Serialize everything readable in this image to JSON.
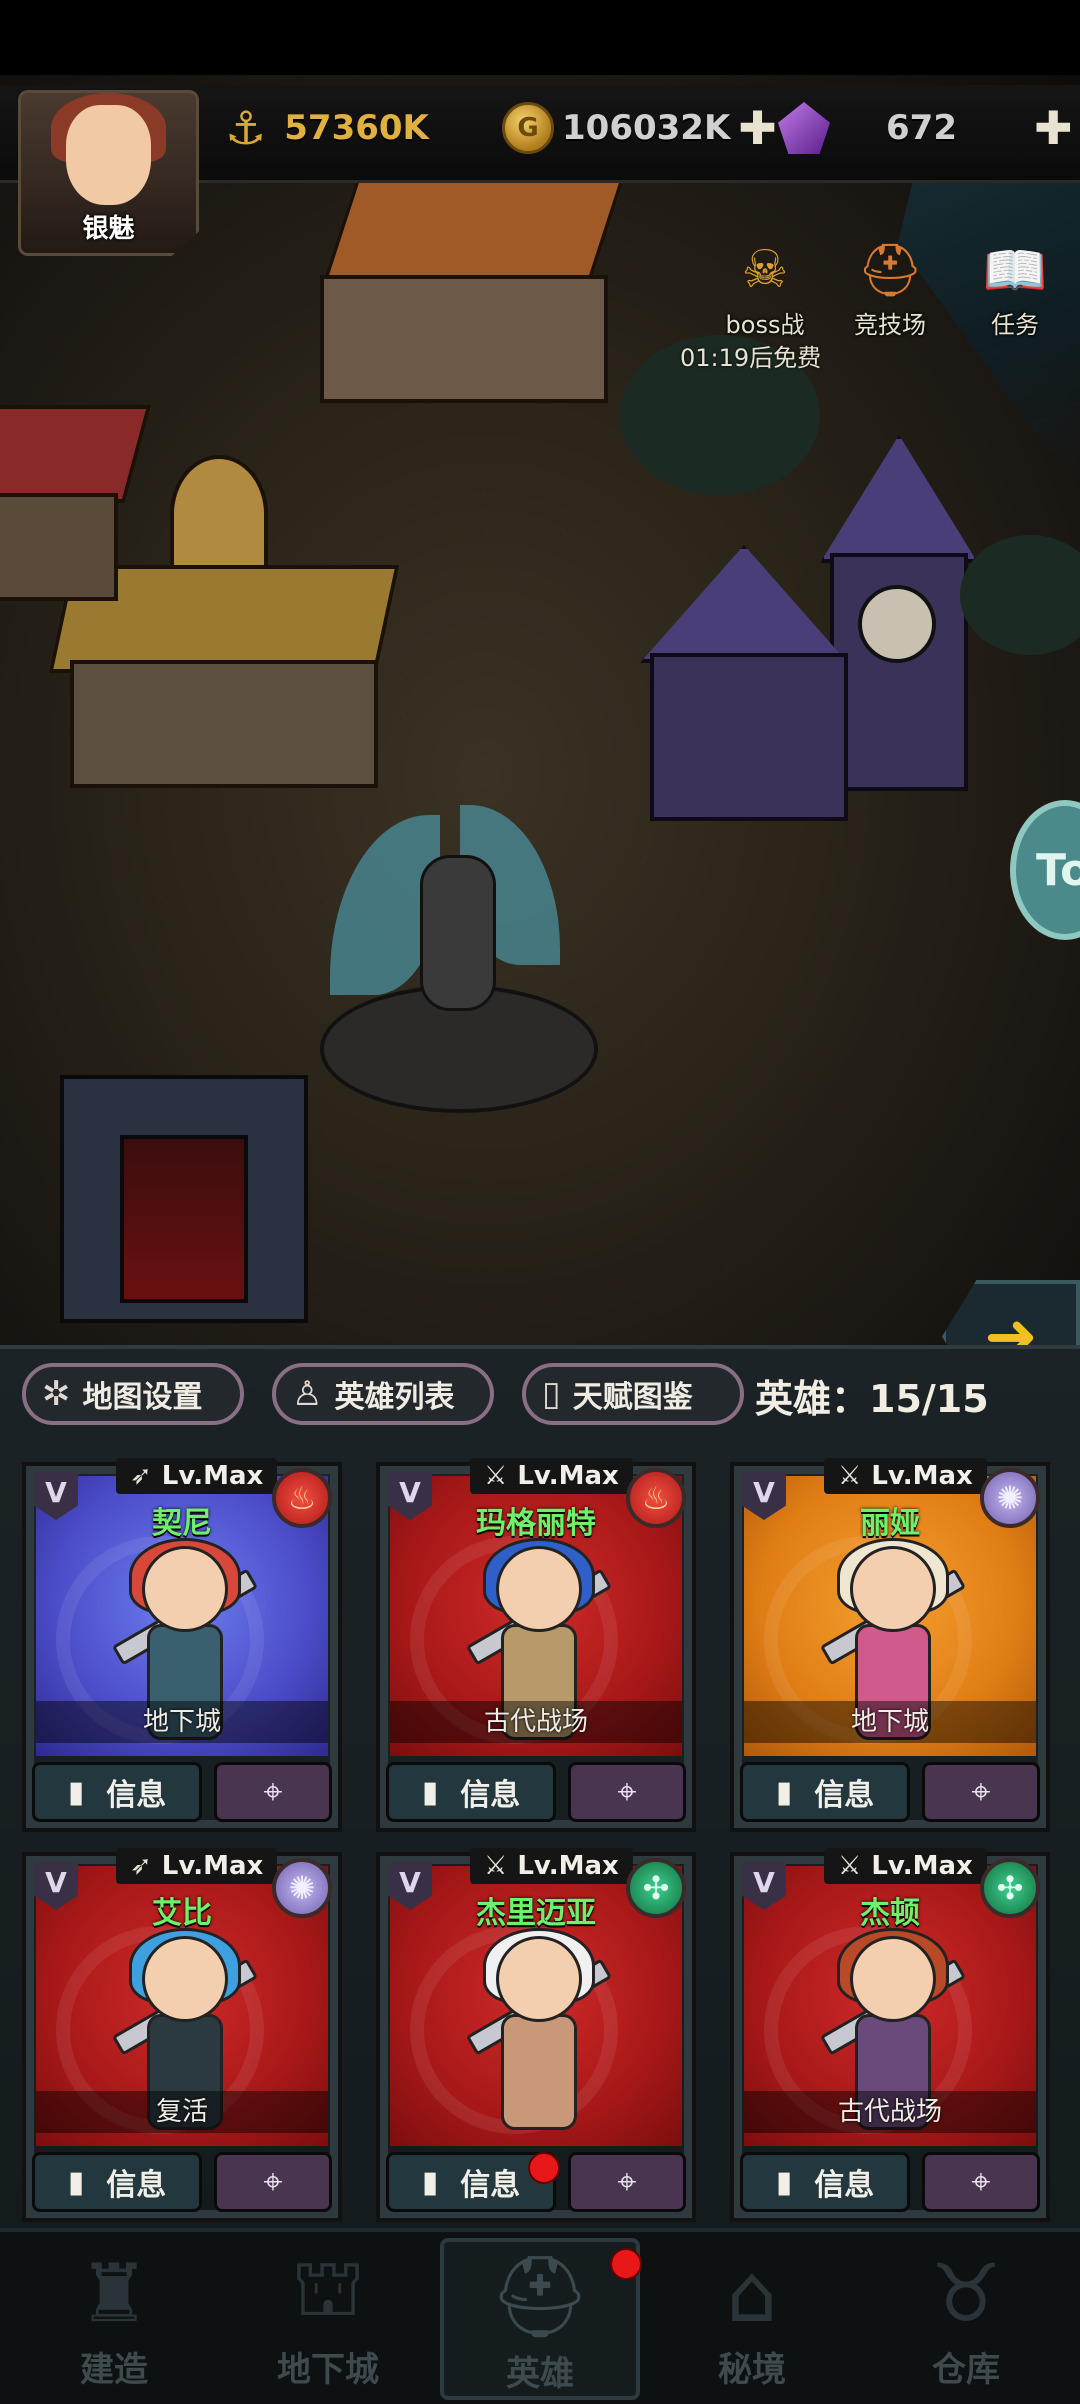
{
  "player": {
    "name": "银魅"
  },
  "resources": {
    "power": "57360K",
    "gold": "106032K",
    "gems": "672"
  },
  "menu": {
    "boss": {
      "label": "boss战",
      "timer": "01:19后免费"
    },
    "arena": {
      "label": "竞技场"
    },
    "quest": {
      "label": "任务"
    }
  },
  "side_button": {
    "label": "To"
  },
  "tabs": [
    {
      "label": "地图设置"
    },
    {
      "label": "英雄列表"
    },
    {
      "label": "天赋图鉴"
    }
  ],
  "hero_count": "英雄：15/15",
  "heroes": [
    {
      "name": "契尼",
      "level": "Lv.Max",
      "weapon": "bow",
      "element": "fire",
      "color": "blue",
      "location": "地下城",
      "info": "信息",
      "hair": "#d8483a",
      "outfit": "#3a6070"
    },
    {
      "name": "玛格丽特",
      "level": "Lv.Max",
      "weapon": "sword",
      "element": "fire",
      "color": "red",
      "location": "古代战场",
      "info": "信息",
      "hair": "#2f5fc8",
      "outfit": "#b89a6a"
    },
    {
      "name": "丽娅",
      "level": "Lv.Max",
      "weapon": "sword",
      "element": "light",
      "color": "orange",
      "location": "地下城",
      "info": "信息",
      "hair": "#efe6d0",
      "outfit": "#d05a8a"
    },
    {
      "name": "艾比",
      "level": "Lv.Max",
      "weapon": "bow",
      "element": "light",
      "color": "red",
      "location": "复活",
      "info": "信息",
      "hair": "#3fa0e0",
      "outfit": "#2a3a40"
    },
    {
      "name": "杰里迈亚",
      "level": "Lv.Max",
      "weapon": "sword",
      "element": "wind",
      "color": "red",
      "location": "",
      "info": "信息",
      "hair": "#f0f0f0",
      "outfit": "#c89878"
    },
    {
      "name": "杰顿",
      "level": "Lv.Max",
      "weapon": "sword",
      "element": "wind",
      "color": "red",
      "location": "古代战场",
      "info": "信息",
      "hair": "#b84a28",
      "outfit": "#6a4a7a"
    }
  ],
  "nav": [
    {
      "label": "建造"
    },
    {
      "label": "地下城"
    },
    {
      "label": "英雄"
    },
    {
      "label": "秘境"
    },
    {
      "label": "仓库"
    }
  ]
}
